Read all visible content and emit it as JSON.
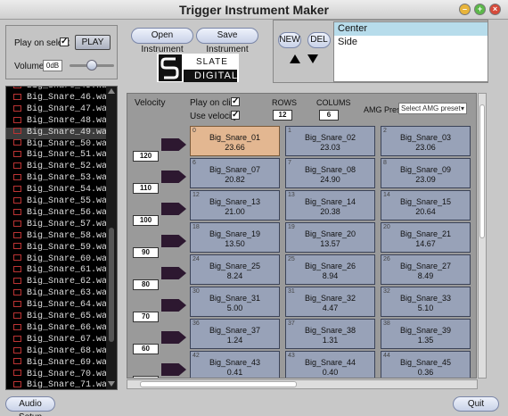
{
  "window": {
    "title": "Trigger Instrument Maker"
  },
  "left_panel": {
    "play_on_select_label": "Play on select",
    "play_label": "PLAY",
    "volume_label": "Volume",
    "volume_value": "0dB",
    "volume_level": 0.5
  },
  "buttons": {
    "open_instrument": "Open Instrument",
    "save_instrument": "Save Instrument",
    "new": "NEW",
    "del": "DEL",
    "audio_setup": "Audio Setup",
    "quit": "Quit"
  },
  "logo": {
    "brand_line1": "SLATE",
    "brand_line2": "DIGITAL"
  },
  "presets": {
    "items": [
      "Center",
      "Side"
    ],
    "selected": 0
  },
  "files": [
    "Big_Snare_45.wav",
    "Big_Snare_46.wav",
    "Big_Snare_47.wav",
    "Big_Snare_48.wav",
    "Big_Snare_49.wav",
    "Big_Snare_50.wav",
    "Big_Snare_51.wav",
    "Big_Snare_52.wav",
    "Big_Snare_53.wav",
    "Big_Snare_54.wav",
    "Big_Snare_55.wav",
    "Big_Snare_56.wav",
    "Big_Snare_57.wav",
    "Big_Snare_58.wav",
    "Big_Snare_59.wav",
    "Big_Snare_60.wav",
    "Big_Snare_61.wav",
    "Big_Snare_62.wav",
    "Big_Snare_63.wav",
    "Big_Snare_64.wav",
    "Big_Snare_65.wav",
    "Big_Snare_66.wav",
    "Big_Snare_67.wav",
    "Big_Snare_68.wav",
    "Big_Snare_69.wav",
    "Big_Snare_70.wav",
    "Big_Snare_71.wav"
  ],
  "selected_file": 4,
  "grid_header": {
    "velocity_label": "Velocity",
    "play_on_click_label": "Play on click",
    "use_velocity_label": "Use velocity",
    "rows_label": "ROWS",
    "rows_value": "12",
    "colums_label": "COLUMS",
    "colums_value": "6",
    "amg_preset_label": "AMG Preset",
    "amg_preset_select": "Select AMG preset"
  },
  "velocities": [
    "120",
    "110",
    "100",
    "90",
    "80",
    "70",
    "60",
    "50"
  ],
  "pads": [
    [
      {
        "i": "0",
        "n": "Big_Snare_01",
        "v": "23.66",
        "on": true
      },
      {
        "i": "1",
        "n": "Big_Snare_02",
        "v": "23.03"
      },
      {
        "i": "2",
        "n": "Big_Snare_03",
        "v": "23.06"
      }
    ],
    [
      {
        "i": "6",
        "n": "Big_Snare_07",
        "v": "20.82"
      },
      {
        "i": "7",
        "n": "Big_Snare_08",
        "v": "24.90"
      },
      {
        "i": "8",
        "n": "Big_Snare_09",
        "v": "23.09"
      }
    ],
    [
      {
        "i": "12",
        "n": "Big_Snare_13",
        "v": "21.00"
      },
      {
        "i": "13",
        "n": "Big_Snare_14",
        "v": "20.38"
      },
      {
        "i": "14",
        "n": "Big_Snare_15",
        "v": "20.64"
      }
    ],
    [
      {
        "i": "18",
        "n": "Big_Snare_19",
        "v": "13.50"
      },
      {
        "i": "19",
        "n": "Big_Snare_20",
        "v": "13.57"
      },
      {
        "i": "20",
        "n": "Big_Snare_21",
        "v": "14.67"
      }
    ],
    [
      {
        "i": "24",
        "n": "Big_Snare_25",
        "v": "8.24"
      },
      {
        "i": "25",
        "n": "Big_Snare_26",
        "v": "8.94"
      },
      {
        "i": "26",
        "n": "Big_Snare_27",
        "v": "8.49"
      }
    ],
    [
      {
        "i": "30",
        "n": "Big_Snare_31",
        "v": "5.00"
      },
      {
        "i": "31",
        "n": "Big_Snare_32",
        "v": "4.47"
      },
      {
        "i": "32",
        "n": "Big_Snare_33",
        "v": "5.10"
      }
    ],
    [
      {
        "i": "36",
        "n": "Big_Snare_37",
        "v": "1.24"
      },
      {
        "i": "37",
        "n": "Big_Snare_38",
        "v": "1.31"
      },
      {
        "i": "38",
        "n": "Big_Snare_39",
        "v": "1.35"
      }
    ],
    [
      {
        "i": "42",
        "n": "Big_Snare_43",
        "v": "0.41"
      },
      {
        "i": "43",
        "n": "Big_Snare_44",
        "v": "0.40"
      },
      {
        "i": "44",
        "n": "Big_Snare_45",
        "v": "0.36"
      }
    ]
  ]
}
